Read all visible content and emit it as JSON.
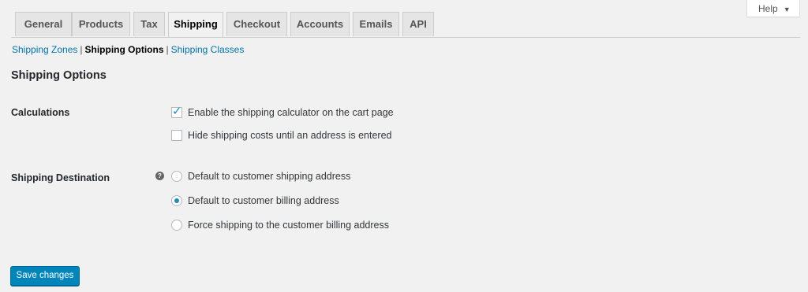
{
  "help": {
    "label": "Help",
    "caret": "▼"
  },
  "tabs": [
    {
      "label": "General"
    },
    {
      "label": "Products"
    },
    {
      "label": "Tax"
    },
    {
      "label": "Shipping",
      "active": true
    },
    {
      "label": "Checkout"
    },
    {
      "label": "Accounts"
    },
    {
      "label": "Emails"
    },
    {
      "label": "API"
    }
  ],
  "subnav": {
    "zones": "Shipping Zones",
    "options": "Shipping Options",
    "classes": "Shipping Classes",
    "separator": "|"
  },
  "page_title": "Shipping Options",
  "calculations": {
    "label": "Calculations",
    "options": [
      {
        "label": "Enable the shipping calculator on the cart page",
        "checked": true
      },
      {
        "label": "Hide shipping costs until an address is entered",
        "checked": false
      }
    ]
  },
  "destination": {
    "label": "Shipping Destination",
    "help_icon": "question-icon",
    "help_glyph": "?",
    "options": [
      {
        "label": "Default to customer shipping address",
        "selected": false
      },
      {
        "label": "Default to customer billing address",
        "selected": true
      },
      {
        "label": "Force shipping to the customer billing address",
        "selected": false
      }
    ]
  },
  "save_label": "Save changes",
  "colors": {
    "accent": "#0085ba",
    "link": "#0073aa",
    "background": "#f1f1f1"
  }
}
